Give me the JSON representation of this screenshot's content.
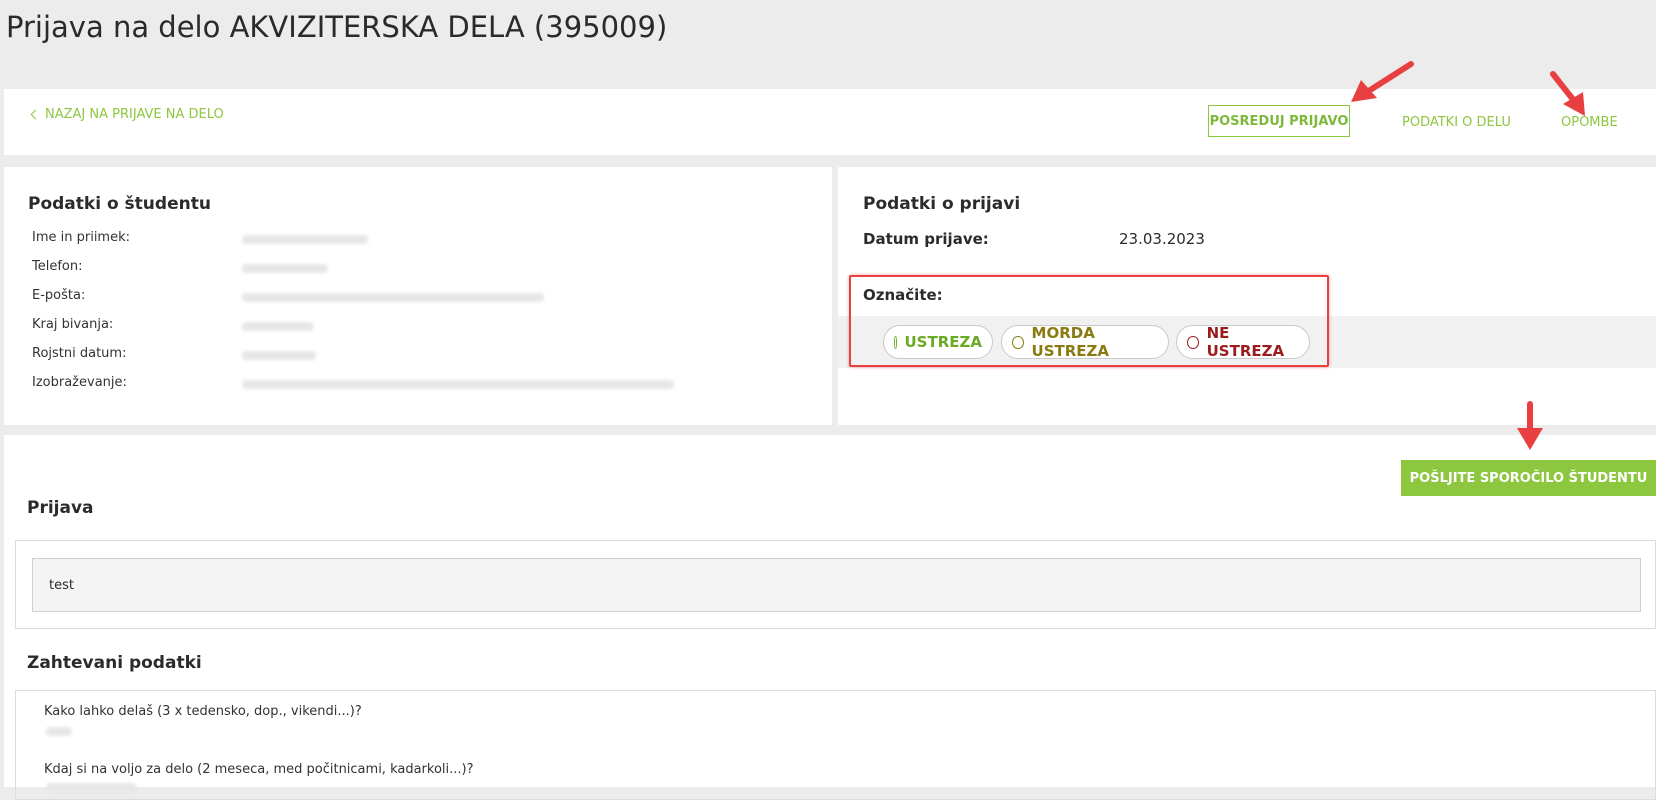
{
  "page": {
    "title": "Prijava na delo AKVIZITERSKA DELA (395009)"
  },
  "topbar": {
    "back_label": "NAZAJ NA PRIJAVE NA DELO",
    "forward_label": "POSREDUJ PRIJAVO",
    "job_info_label": "PODATKI O DELU",
    "notes_label": "OPOMBE"
  },
  "student": {
    "title": "Podatki o študentu",
    "fields": [
      {
        "label": "Ime in priimek:"
      },
      {
        "label": "Telefon:"
      },
      {
        "label": "E-pošta:"
      },
      {
        "label": "Kraj bivanja:"
      },
      {
        "label": "Rojstni datum:"
      },
      {
        "label": "Izobraževanje:"
      }
    ]
  },
  "application": {
    "title": "Podatki o prijavi",
    "date_label": "Datum prijave:",
    "date_value": "23.03.2023",
    "mark_label": "Označite:",
    "options": [
      {
        "label": "USTREZA",
        "color": "#6aaa24"
      },
      {
        "label": "MORDA USTREZA",
        "color": "#8a7a12"
      },
      {
        "label": "NE USTREZA",
        "color": "#9b1c1c"
      }
    ]
  },
  "bottom": {
    "send_label": "POŠLJITE SPOROČILO ŠTUDENTU",
    "prijava_title": "Prijava",
    "prijava_text": "test",
    "required_title": "Zahtevani podatki",
    "questions": [
      "Kako lahko delaš (3 x tedensko, dop., vikendi...)?",
      "Kdaj si na voljo za delo (2 meseca, med počitnicami, kadarkoli...)?"
    ]
  },
  "colors": {
    "accent": "#8dc63f",
    "highlight": "#e84040"
  }
}
